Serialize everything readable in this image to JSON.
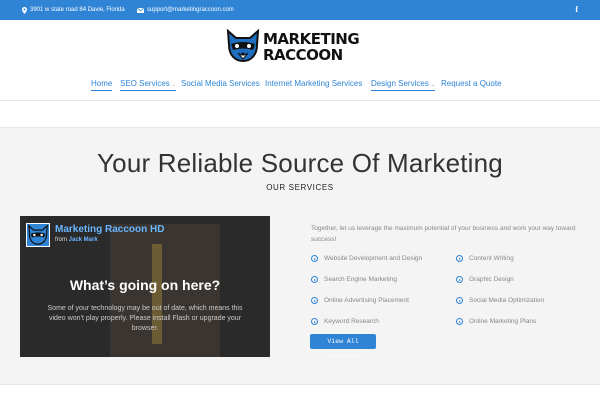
{
  "topbar": {
    "address": "3901 w state road 84 Davie, Florida",
    "email": "support@marketingraccoon.com",
    "social_icon": "facebook-icon",
    "social_glyph": "f"
  },
  "logo": {
    "line1": "MARKETING",
    "line2": "RACCOON"
  },
  "nav": {
    "items": [
      {
        "label": "Home"
      },
      {
        "label": "SEO Services"
      },
      {
        "label": "Social Media Services"
      },
      {
        "label": "Internet Marketing Services"
      },
      {
        "label": "Design Services"
      },
      {
        "label": "Request a Quote"
      }
    ]
  },
  "hero": {
    "title": "Your Reliable Source Of Marketing",
    "subtitle": "OUR SERVICES"
  },
  "video": {
    "title": "Marketing Raccoon HD",
    "from_label": "from",
    "author": "Jack Mark",
    "message_title": "What’s going on here?",
    "message_body": "Some of your technology may be out of date, which means this video won’t play properly. Please install Flash or upgrade your browser."
  },
  "services": {
    "intro": "Together, let us leverage the maximum potential of your business and work your way toward success!",
    "left": [
      "Website Development and Design",
      "Search Engine Marketing",
      "Online Advertising Placement",
      "Keyword Research"
    ],
    "right": [
      "Content Writing",
      "Graphic Design",
      "Social Media Optimization",
      "Online Marketing Plans"
    ],
    "button": "View All Features"
  },
  "colors": {
    "accent": "#2f84d6",
    "text": "#333333",
    "muted": "#888888"
  }
}
